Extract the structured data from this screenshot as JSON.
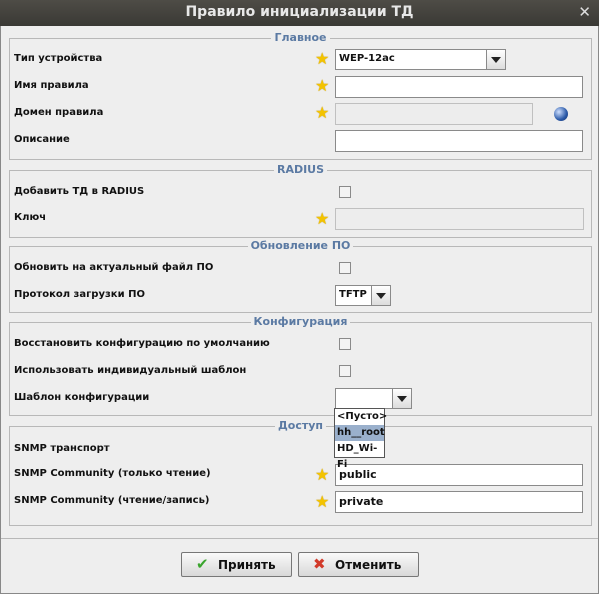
{
  "window": {
    "title": "Правило инициализации ТД"
  },
  "sections": {
    "main": {
      "legend": "Главное",
      "device_type_label": "Тип устройства",
      "device_type_value": "WEP-12ac",
      "rule_name_label": "Имя правила",
      "rule_name_value": "",
      "rule_domain_label": "Домен правила",
      "rule_domain_value": "",
      "description_label": "Описание",
      "description_value": ""
    },
    "radius": {
      "legend": "RADIUS",
      "add_ap_label": "Добавить ТД в RADIUS",
      "add_ap_checked": false,
      "key_label": "Ключ",
      "key_value": ""
    },
    "firmware": {
      "legend": "Обновление ПО",
      "update_label": "Обновить на актуальный файл ПО",
      "update_checked": false,
      "protocol_label": "Протокол загрузки ПО",
      "protocol_value": "TFTP"
    },
    "config": {
      "legend": "Конфигурация",
      "restore_label": "Восстановить конфигурацию по умолчанию",
      "restore_checked": false,
      "individual_label": "Использовать индивидуальный шаблон",
      "individual_checked": false,
      "template_label": "Шаблон конфигурации",
      "template_value": "",
      "template_options": [
        "<Пусто>",
        "hh__root",
        "HD_Wi-Fi"
      ],
      "template_highlighted": "hh__root"
    },
    "access": {
      "legend": "Доступ",
      "snmp_transport_label": "SNMP транспорт",
      "snmp_ro_label": "SNMP Community (только чтение)",
      "snmp_ro_value": "public",
      "snmp_rw_label": "SNMP Community (чтение/запись)",
      "snmp_rw_value": "private"
    }
  },
  "buttons": {
    "accept_label": "Принять",
    "cancel_label": "Отменить"
  },
  "icons": {
    "close": "close-icon",
    "required": "star-icon",
    "domain_picker": "globe-icon",
    "accept": "checkmark-icon",
    "cancel": "cross-icon"
  },
  "colors": {
    "legend": "#5b7aa3",
    "star": "#f3c300",
    "titlebar": "#3f3e3a",
    "selected_option": "#9ab0cc",
    "accept_icon": "#3aa52e",
    "cancel_icon": "#d23a2a"
  }
}
